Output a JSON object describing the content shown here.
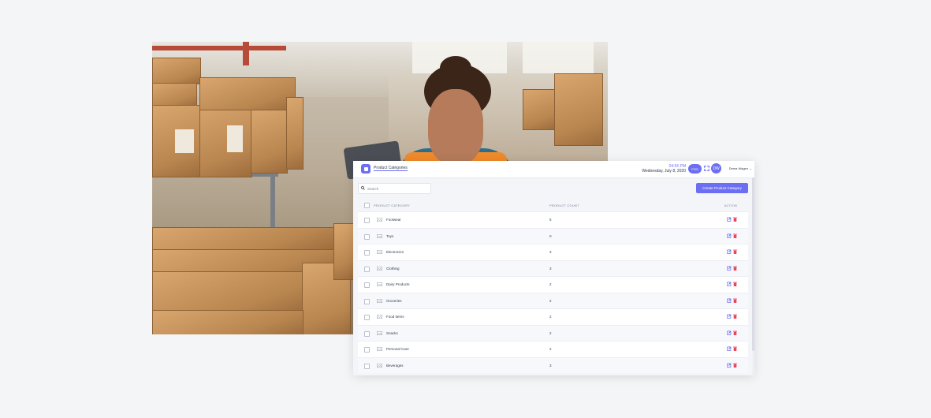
{
  "app": {
    "page_title": "Product Categories",
    "clock": "04:55 PM",
    "date": "Wednesday, July 8, 2020",
    "pos_label": "POS",
    "avatar_initials": "DW",
    "username": "Dema Wagen",
    "search_placeholder": "Search",
    "create_button": "Create Product Category",
    "accent_color": "#6c6ff2",
    "delete_color": "#e8455b"
  },
  "table": {
    "headers": {
      "name": "PRODUCT CATEGORY",
      "count": "PRODUCT COUNT",
      "action": "ACTION"
    },
    "rows": [
      {
        "name": "Footwear",
        "count": "5"
      },
      {
        "name": "Toys",
        "count": "0"
      },
      {
        "name": "Electronics",
        "count": "3"
      },
      {
        "name": "Clothing",
        "count": "3"
      },
      {
        "name": "Dairy Products",
        "count": "2"
      },
      {
        "name": "Groceries",
        "count": "2"
      },
      {
        "name": "Food Items",
        "count": "2"
      },
      {
        "name": "Snacks",
        "count": "2"
      },
      {
        "name": "Personal Care",
        "count": "2"
      },
      {
        "name": "Beverages",
        "count": "3"
      }
    ]
  }
}
